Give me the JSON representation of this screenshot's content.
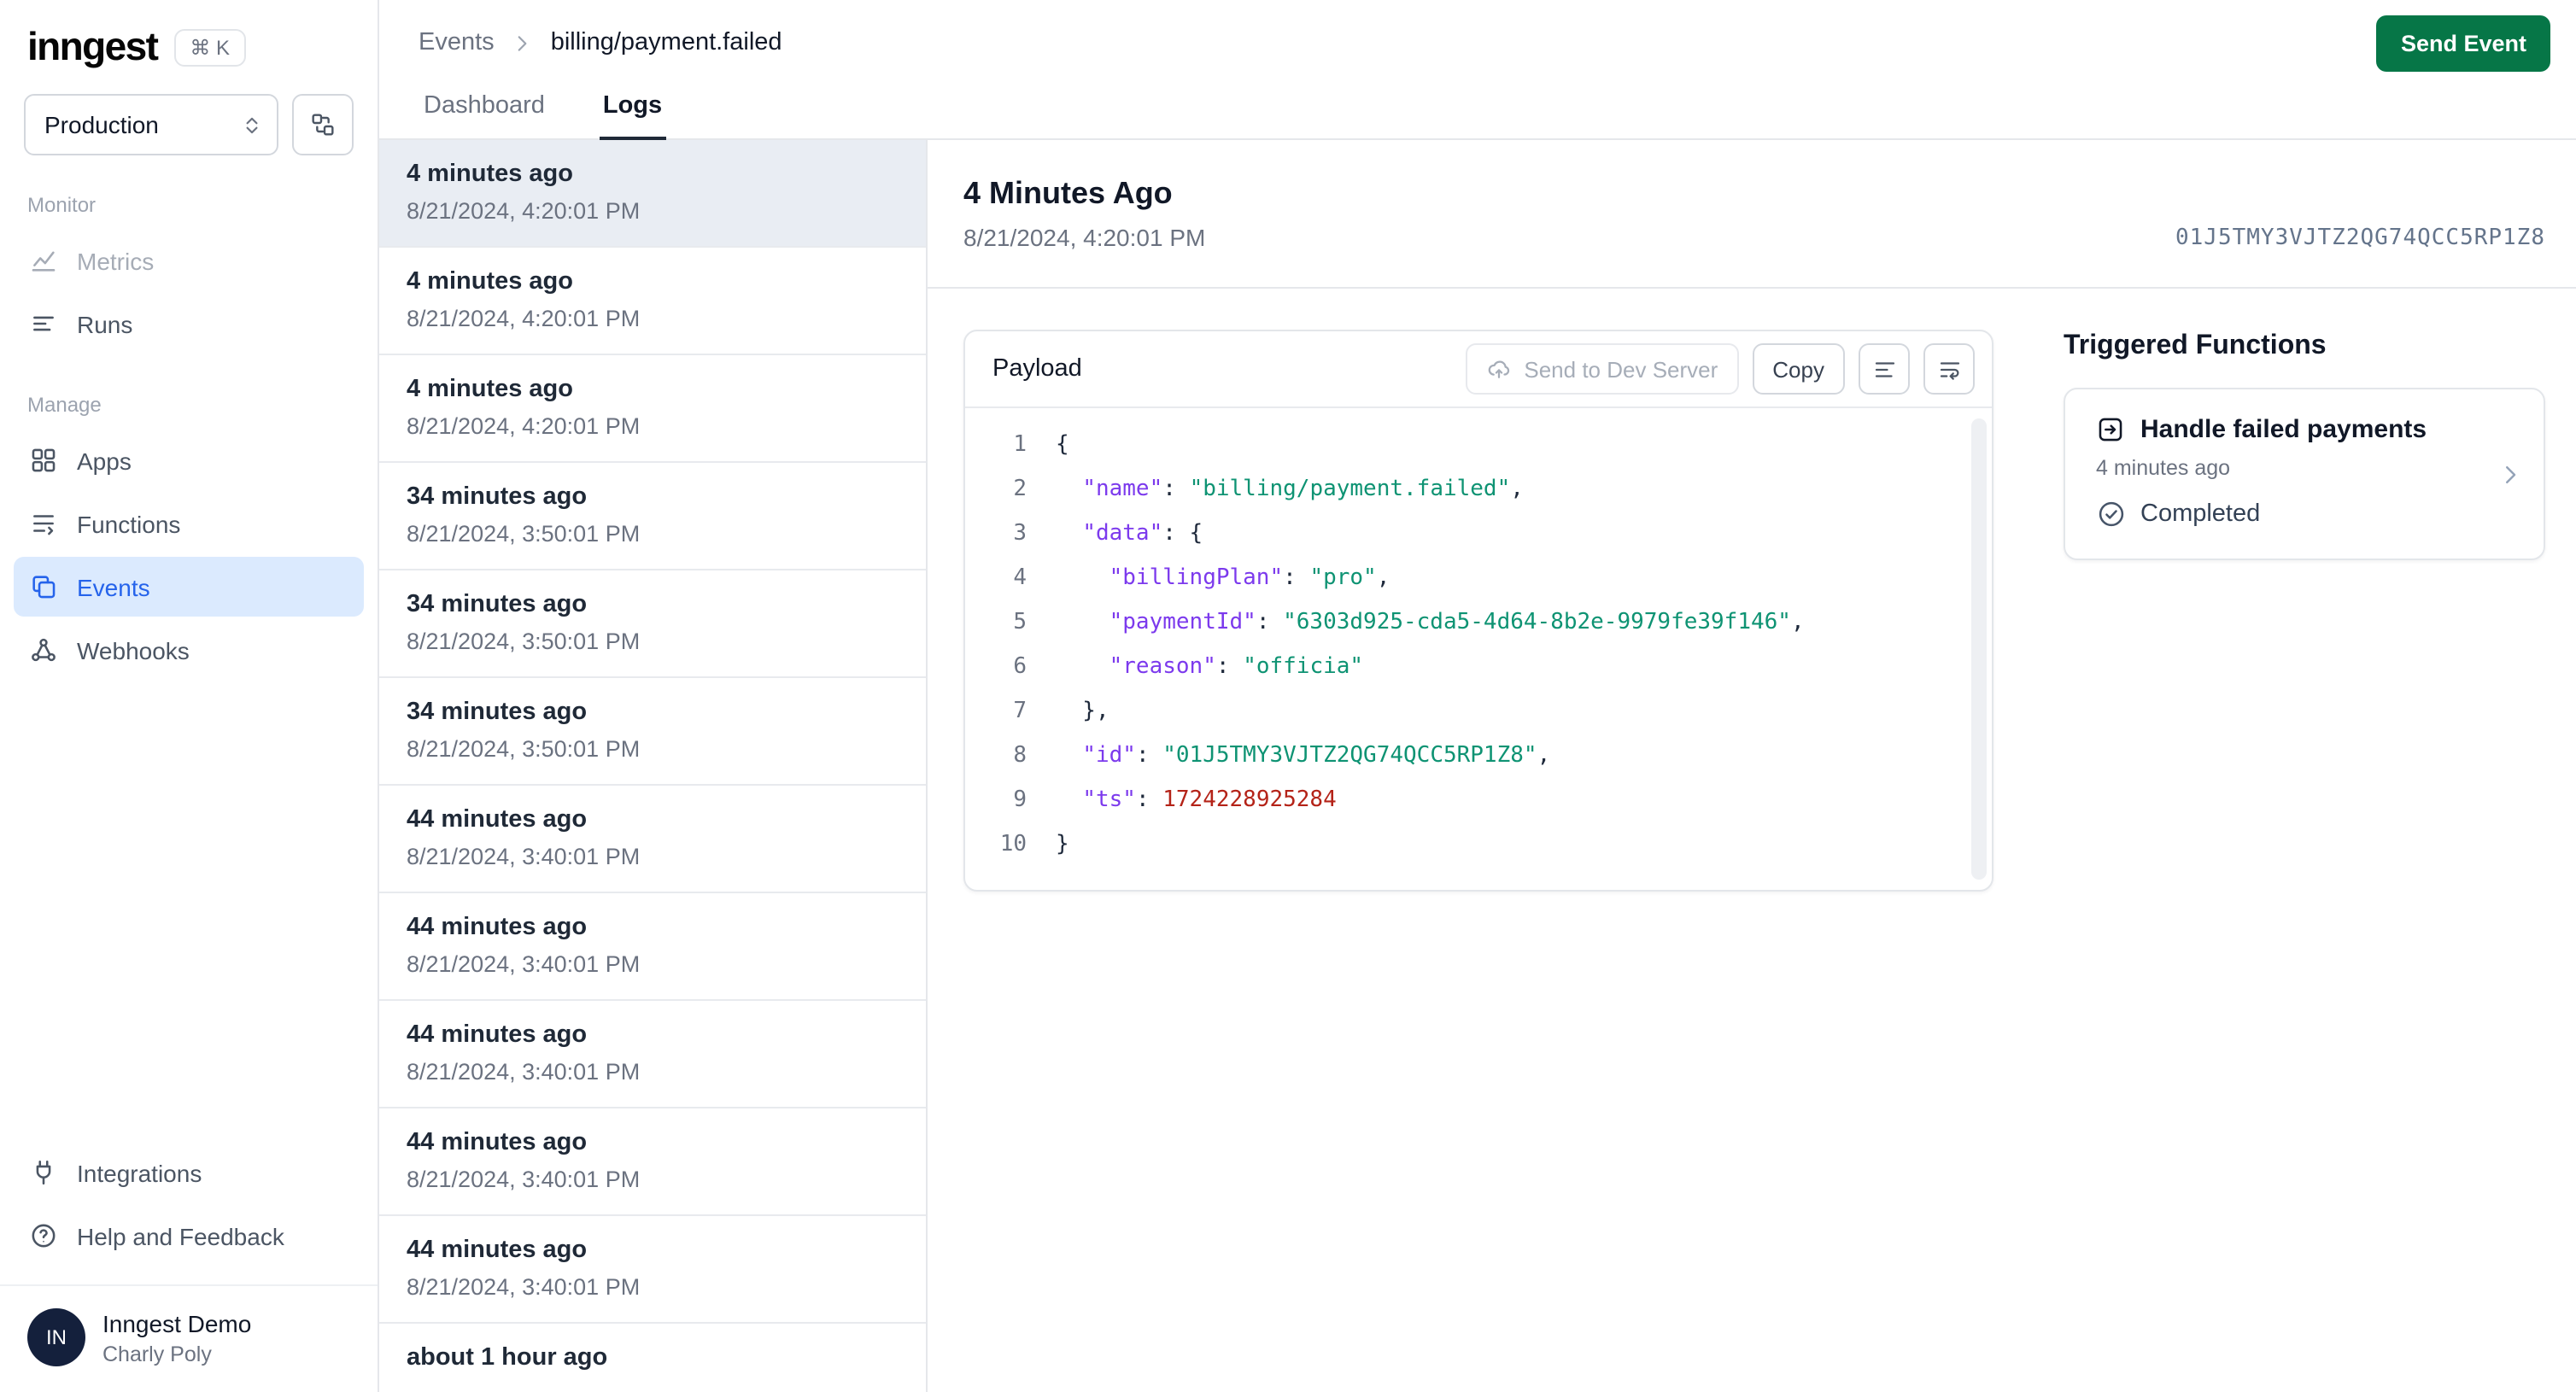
{
  "sidebar": {
    "logo_text": "inngest",
    "shortcut_badge": "⌘ K",
    "environment": {
      "selected": "Production"
    },
    "sections": [
      {
        "label": "Monitor",
        "items": [
          {
            "label": "Metrics"
          },
          {
            "label": "Runs"
          }
        ]
      },
      {
        "label": "Manage",
        "items": [
          {
            "label": "Apps"
          },
          {
            "label": "Functions"
          },
          {
            "label": "Events"
          },
          {
            "label": "Webhooks"
          }
        ]
      }
    ],
    "footer_items": [
      {
        "label": "Integrations"
      },
      {
        "label": "Help and Feedback"
      }
    ],
    "user": {
      "initials": "IN",
      "name": "Inngest Demo",
      "subtitle": "Charly Poly"
    }
  },
  "header": {
    "breadcrumb": {
      "parent": "Events",
      "current": "billing/payment.failed"
    },
    "send_event_button": "Send Event"
  },
  "tabs": [
    {
      "label": "Dashboard",
      "active": false
    },
    {
      "label": "Logs",
      "active": true
    }
  ],
  "event_list": [
    {
      "relative": "4 minutes ago",
      "timestamp": "8/21/2024, 4:20:01 PM",
      "selected": true
    },
    {
      "relative": "4 minutes ago",
      "timestamp": "8/21/2024, 4:20:01 PM",
      "selected": false
    },
    {
      "relative": "4 minutes ago",
      "timestamp": "8/21/2024, 4:20:01 PM",
      "selected": false
    },
    {
      "relative": "34 minutes ago",
      "timestamp": "8/21/2024, 3:50:01 PM",
      "selected": false
    },
    {
      "relative": "34 minutes ago",
      "timestamp": "8/21/2024, 3:50:01 PM",
      "selected": false
    },
    {
      "relative": "34 minutes ago",
      "timestamp": "8/21/2024, 3:50:01 PM",
      "selected": false
    },
    {
      "relative": "44 minutes ago",
      "timestamp": "8/21/2024, 3:40:01 PM",
      "selected": false
    },
    {
      "relative": "44 minutes ago",
      "timestamp": "8/21/2024, 3:40:01 PM",
      "selected": false
    },
    {
      "relative": "44 minutes ago",
      "timestamp": "8/21/2024, 3:40:01 PM",
      "selected": false
    },
    {
      "relative": "44 minutes ago",
      "timestamp": "8/21/2024, 3:40:01 PM",
      "selected": false
    },
    {
      "relative": "44 minutes ago",
      "timestamp": "8/21/2024, 3:40:01 PM",
      "selected": false
    },
    {
      "relative": "about 1 hour ago",
      "timestamp": "",
      "selected": false
    }
  ],
  "detail": {
    "title": "4 Minutes Ago",
    "timestamp": "8/21/2024, 4:20:01 PM",
    "event_id": "01J5TMY3VJTZ2QG74QCC5RP1Z8",
    "payload": {
      "title": "Payload",
      "send_dev_button": "Send to Dev Server",
      "copy_button": "Copy",
      "code_lines": [
        {
          "n": 1,
          "tokens": [
            {
              "t": "plain",
              "v": "{"
            }
          ]
        },
        {
          "n": 2,
          "tokens": [
            {
              "t": "plain",
              "v": "  "
            },
            {
              "t": "key",
              "v": "\"name\""
            },
            {
              "t": "plain",
              "v": ": "
            },
            {
              "t": "str",
              "v": "\"billing/payment.failed\""
            },
            {
              "t": "plain",
              "v": ","
            }
          ]
        },
        {
          "n": 3,
          "tokens": [
            {
              "t": "plain",
              "v": "  "
            },
            {
              "t": "key",
              "v": "\"data\""
            },
            {
              "t": "plain",
              "v": ": {"
            }
          ]
        },
        {
          "n": 4,
          "tokens": [
            {
              "t": "plain",
              "v": "    "
            },
            {
              "t": "key",
              "v": "\"billingPlan\""
            },
            {
              "t": "plain",
              "v": ": "
            },
            {
              "t": "str",
              "v": "\"pro\""
            },
            {
              "t": "plain",
              "v": ","
            }
          ]
        },
        {
          "n": 5,
          "tokens": [
            {
              "t": "plain",
              "v": "    "
            },
            {
              "t": "key",
              "v": "\"paymentId\""
            },
            {
              "t": "plain",
              "v": ": "
            },
            {
              "t": "str",
              "v": "\"6303d925-cda5-4d64-8b2e-9979fe39f146\""
            },
            {
              "t": "plain",
              "v": ","
            }
          ]
        },
        {
          "n": 6,
          "tokens": [
            {
              "t": "plain",
              "v": "    "
            },
            {
              "t": "key",
              "v": "\"reason\""
            },
            {
              "t": "plain",
              "v": ": "
            },
            {
              "t": "str",
              "v": "\"officia\""
            }
          ]
        },
        {
          "n": 7,
          "tokens": [
            {
              "t": "plain",
              "v": "  },"
            }
          ]
        },
        {
          "n": 8,
          "tokens": [
            {
              "t": "plain",
              "v": "  "
            },
            {
              "t": "key",
              "v": "\"id\""
            },
            {
              "t": "plain",
              "v": ": "
            },
            {
              "t": "str",
              "v": "\"01J5TMY3VJTZ2QG74QCC5RP1Z8\""
            },
            {
              "t": "plain",
              "v": ","
            }
          ]
        },
        {
          "n": 9,
          "tokens": [
            {
              "t": "plain",
              "v": "  "
            },
            {
              "t": "key",
              "v": "\"ts\""
            },
            {
              "t": "plain",
              "v": ": "
            },
            {
              "t": "num",
              "v": "1724228925284"
            }
          ]
        },
        {
          "n": 10,
          "tokens": [
            {
              "t": "plain",
              "v": "}"
            }
          ]
        }
      ]
    },
    "triggered_functions": {
      "title": "Triggered Functions",
      "items": [
        {
          "name": "Handle failed payments",
          "relative": "4 minutes ago",
          "status": "Completed"
        }
      ]
    }
  }
}
